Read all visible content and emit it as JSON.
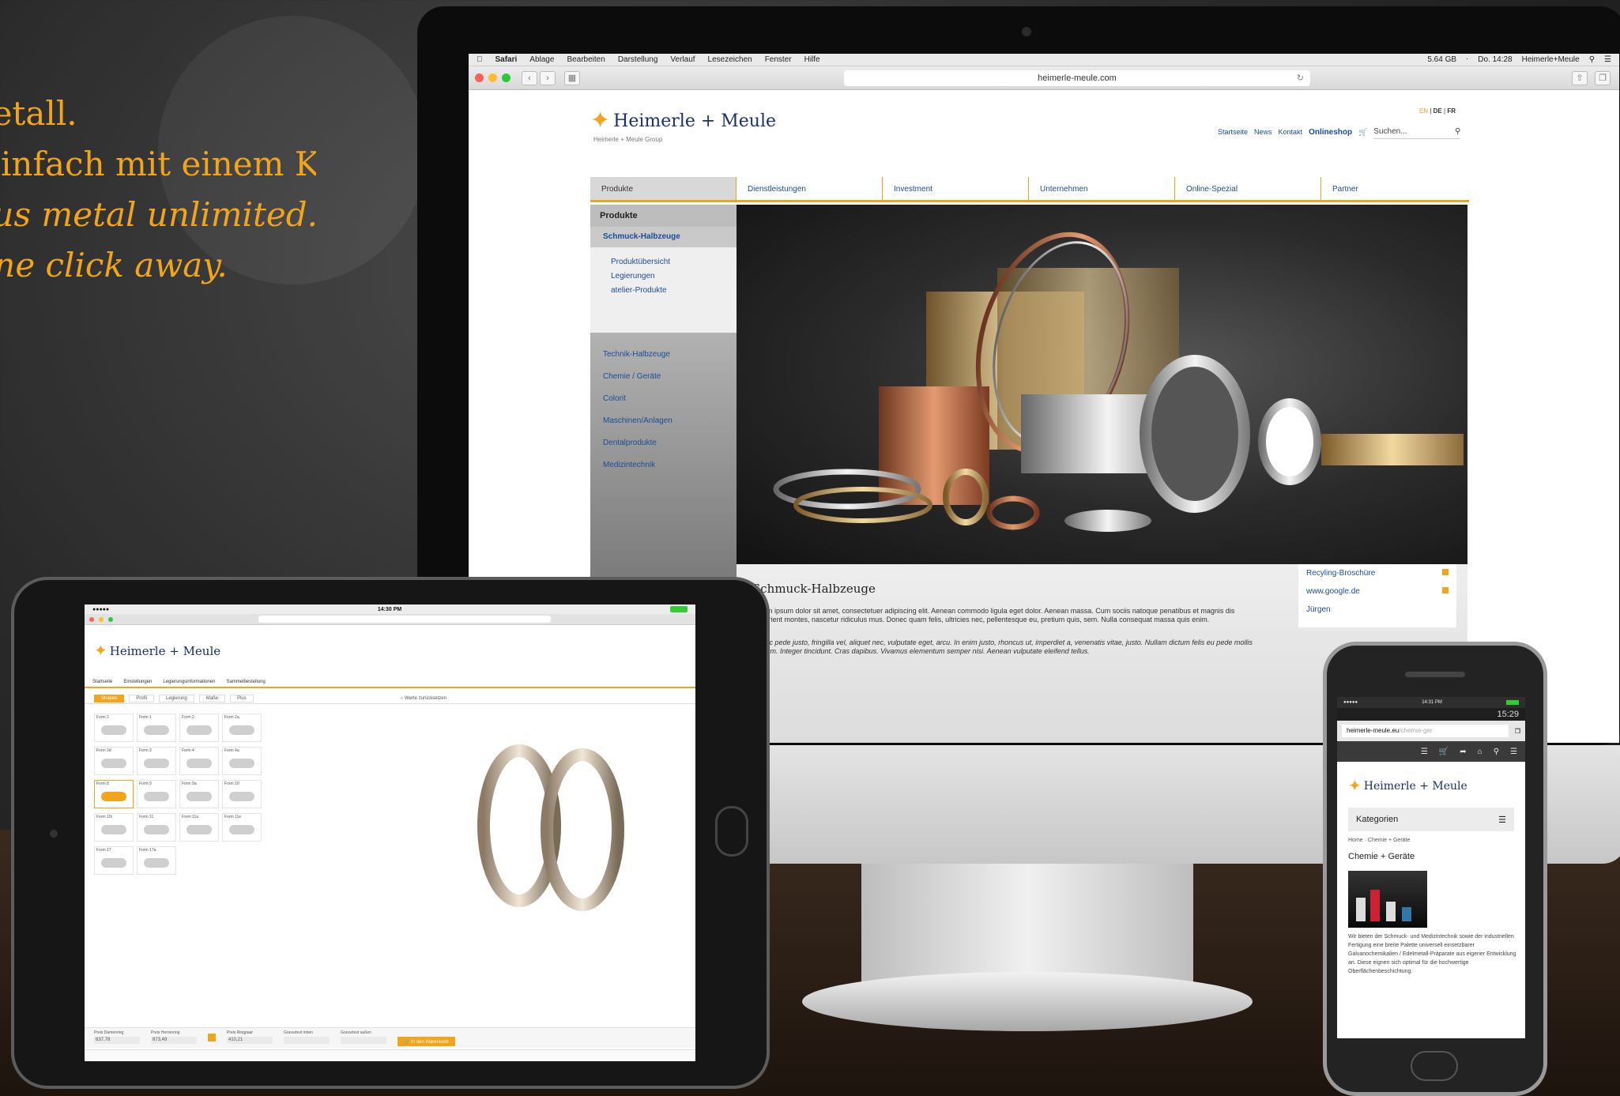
{
  "tagline": {
    "line1": "Edelmetall.",
    "line2": "Ganz einfach mit einem Klick.",
    "line3": "Precious metal unlimited.",
    "line4": "Only one click away."
  },
  "mac": {
    "menu": [
      "Safari",
      "Ablage",
      "Bearbeiten",
      "Darstellung",
      "Verlauf",
      "Lesezeichen",
      "Fenster",
      "Hilfe"
    ],
    "status_right": [
      "5.64 GB",
      "Do. 14:28",
      "Heimerle+Meule"
    ],
    "url": "heimerle-meule.com"
  },
  "site": {
    "logo": "Heimerle + Meule",
    "logo_sub": "Heimerle + Meule Group",
    "lang": {
      "en": "EN",
      "de": "DE",
      "fr": "FR"
    },
    "toplinks": [
      "Startseite",
      "News",
      "Kontakt"
    ],
    "shop": "Onlineshop",
    "search_placeholder": "Suchen...",
    "nav": [
      "Produkte",
      "Dienstleistungen",
      "Investment",
      "Unternehmen",
      "Online-Spezial",
      "Partner"
    ],
    "sidebar": {
      "head": "Produkte",
      "active": "Schmuck-Halbzeuge",
      "subs": [
        "Produktübersicht",
        "Legierungen",
        "atelier-Produkte"
      ],
      "items": [
        "Technik-Halbzeuge",
        "Chemie / Geräte",
        "Colorit",
        "Maschinen/Anlagen",
        "Dentalprodukte",
        "Medizintechnik"
      ]
    },
    "article": {
      "title": "Schmuck-Halbzeuge",
      "p1": "Lorem ipsum dolor sit amet, consectetuer adipiscing elit. Aenean commodo ligula eget dolor. Aenean massa. Cum sociis natoque penatibus et magnis dis parturient montes, nascetur ridiculus mus. Donec quam felis, ultricies nec, pellentesque eu, pretium quis, sem. Nulla consequat massa quis enim.",
      "p2": "Donec pede justo, fringilla vel, aliquet nec, vulputate eget, arcu. In enim justo, rhoncus ut, imperdiet a, venenatis vitae, justo. Nullam dictum felis eu pede mollis pretium. Integer tincidunt. Cras dapibus. Vivamus elementum semper nisi. Aenean vulputate eleifend tellus."
    },
    "links": [
      "Recyling-Broschüre",
      "www.google.de",
      "Jürgen"
    ]
  },
  "ipad": {
    "time": "14:30 PM",
    "nav": [
      "Startseite",
      "Einstellungen",
      "Legierungsinformationen",
      "Sammelbestellung"
    ],
    "tabs": [
      "Shapes",
      "Profil",
      "Legierung",
      "Maße",
      "Plus"
    ],
    "checkbox": "Werte zurücksetzen",
    "forms": [
      "Form 2",
      "Form 1",
      "Form 2",
      "Form 2a",
      "Form 3d",
      "Form 3",
      "Form 4",
      "Form 4a",
      "Form 8",
      "Form 9",
      "Form 9a",
      "Form 10",
      "Form 10i",
      "Form 11",
      "Form 11a",
      "Form 11e",
      "Form 17",
      "Form 17a"
    ],
    "footer": [
      {
        "label": "Preis Damenring",
        "value": "637,78"
      },
      {
        "label": "Preis Herrenring",
        "value": "873,49"
      },
      {
        "label": "Preis Ringpaar",
        "value": "410,21"
      },
      {
        "label": "Gravurtext innen",
        "value": ""
      },
      {
        "label": "Gravurtext außen",
        "value": ""
      }
    ],
    "cart": "In den Warenkorb"
  },
  "phone": {
    "time": "14:31 PM",
    "time2": "15:29",
    "url_host": "heimerle-meule.eu",
    "url_path": "/chemie-ger",
    "logo": "Heimerle + Meule",
    "category": "Kategorien",
    "crumb": "Home · Chemie + Geräte",
    "title": "Chemie + Geräte",
    "text": "Wir bieten der Schmuck- und Medizintechnik sowie der industriellen Fertigung eine breite Palette universell einsetzbarer Galvanochemikalien / Edelmetall-Präparate aus eigener Entwicklung an. Diese eignen sich optimal für die hochwertige Oberflächenbeschichtung."
  }
}
